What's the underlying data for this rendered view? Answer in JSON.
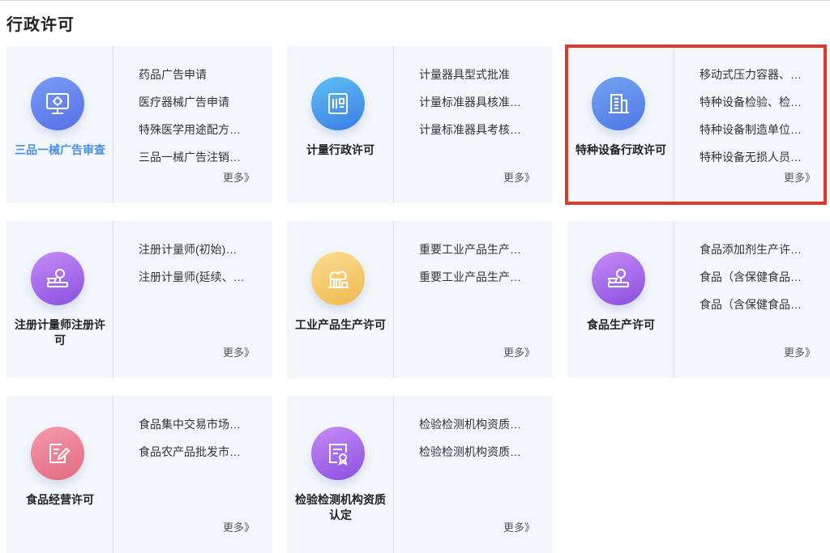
{
  "page": {
    "title": "行政许可"
  },
  "more_label": "更多》",
  "cards": [
    {
      "title": "三品一械广告审查",
      "title_color": "#4a90e2",
      "icon": "monitor-gear-icon",
      "gradient": [
        "#7a9cf6",
        "#5670e6"
      ],
      "links": [
        "药品广告申请",
        "医疗器械广告申请",
        "特殊医学用途配方…",
        "三品一械广告注销…"
      ]
    },
    {
      "title": "计量行政许可",
      "icon": "document-chart-icon",
      "gradient": [
        "#5fc1f5",
        "#3a7ce6"
      ],
      "links": [
        "计量器具型式批准",
        "计量标准器具核准…",
        "计量标准器具考核…"
      ]
    },
    {
      "title": "特种设备行政许可",
      "icon": "building-icon",
      "gradient": [
        "#74a4f3",
        "#4d78e3"
      ],
      "links": [
        "移动式压力容器、…",
        "特种设备检验、检…",
        "特种设备制造单位…",
        "特种设备无损人员…"
      ]
    },
    {
      "title": "注册计量师注册许可",
      "icon": "weighing-scale-icon",
      "gradient": [
        "#c68cf5",
        "#8b4fe0"
      ],
      "links": [
        "注册计量师(初始)…",
        "注册计量师(延续、…"
      ]
    },
    {
      "title": "工业产品生产许可",
      "icon": "factory-icon",
      "gradient": [
        "#fbdd92",
        "#f0b94e"
      ],
      "links": [
        "重要工业产品生产…",
        "重要工业产品生产…"
      ]
    },
    {
      "title": "食品生产许可",
      "icon": "food-scale-icon",
      "gradient": [
        "#c68cf5",
        "#8b4fe0"
      ],
      "links": [
        "食品添加剂生产许…",
        "食品（含保健食品…",
        "食品（含保健食品…"
      ]
    },
    {
      "title": "食品经营许可",
      "icon": "edit-document-icon",
      "gradient": [
        "#f59aac",
        "#e06a82"
      ],
      "links": [
        "食品集中交易市场…",
        "食品农产品批发市…"
      ]
    },
    {
      "title": "检验检测机构资质认定",
      "icon": "certificate-icon",
      "gradient": [
        "#c68cf5",
        "#8b4fe0"
      ],
      "links": [
        "检验检测机构资质…",
        "检验检测机构资质…"
      ]
    }
  ]
}
